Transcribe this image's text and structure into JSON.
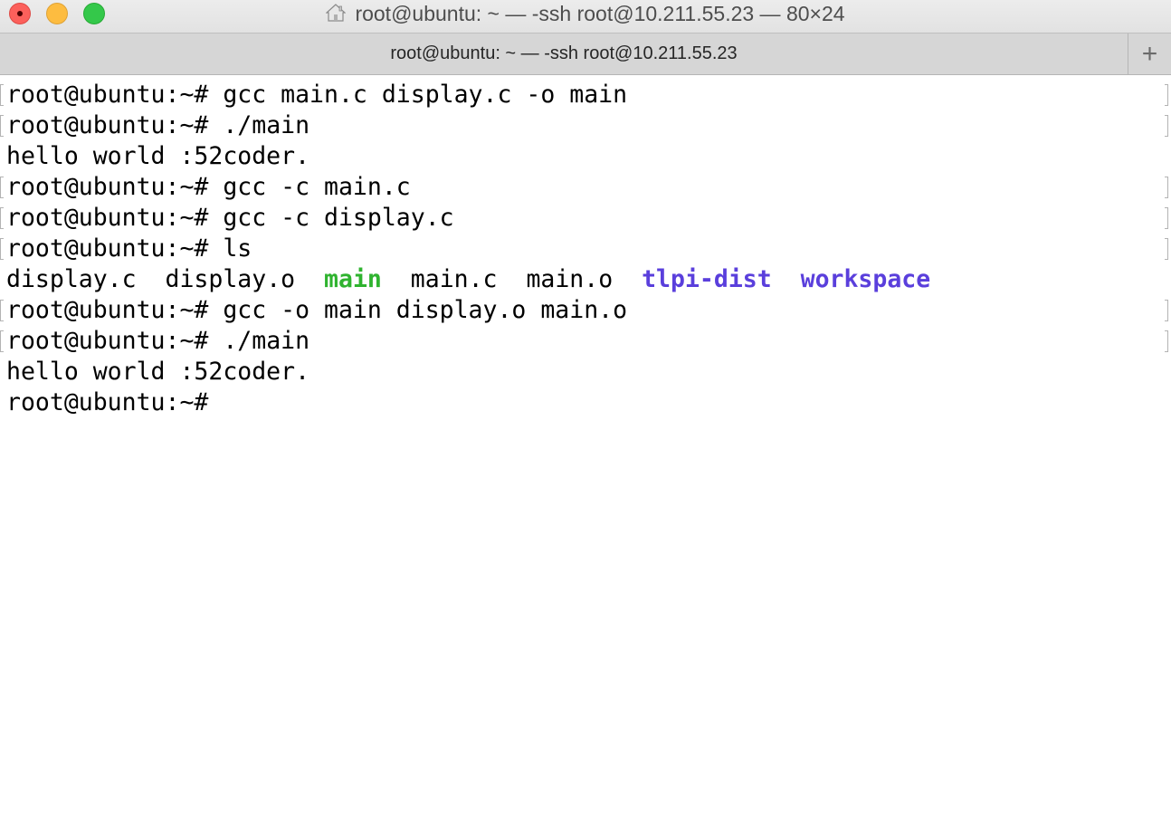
{
  "window": {
    "title": "root@ubuntu: ~ — -ssh root@10.211.55.23 — 80×24",
    "tab_label": "root@ubuntu: ~ — -ssh root@10.211.55.23",
    "new_tab_label": "+"
  },
  "terminal": {
    "prompt": "root@ubuntu:~#",
    "lines": [
      {
        "type": "command",
        "command": " gcc main.c display.c -o main"
      },
      {
        "type": "command",
        "command": " ./main"
      },
      {
        "type": "output",
        "text": "hello world :52coder."
      },
      {
        "type": "command",
        "command": " gcc -c main.c"
      },
      {
        "type": "command",
        "command": " gcc -c display.c"
      },
      {
        "type": "command",
        "command": " ls"
      },
      {
        "type": "listing",
        "items": [
          {
            "name": "display.c",
            "kind": "file"
          },
          {
            "name": "display.o",
            "kind": "file"
          },
          {
            "name": "main",
            "kind": "executable"
          },
          {
            "name": "main.c",
            "kind": "file"
          },
          {
            "name": "main.o",
            "kind": "file"
          },
          {
            "name": "tlpi-dist",
            "kind": "directory"
          },
          {
            "name": "workspace",
            "kind": "directory"
          }
        ]
      },
      {
        "type": "command",
        "command": " gcc -o main display.o main.o"
      },
      {
        "type": "command",
        "command": " ./main"
      },
      {
        "type": "output",
        "text": "hello world :52coder."
      },
      {
        "type": "prompt"
      }
    ]
  },
  "colors": {
    "executable": "#2fb32f",
    "directory": "#5a3fdc",
    "close": "#fc605b",
    "minimize": "#fdbc40",
    "maximize": "#34c84a"
  },
  "icons": {
    "title_icon": "home-icon",
    "close": "close-window-button",
    "minimize": "minimize-window-button",
    "maximize": "zoom-window-button"
  }
}
